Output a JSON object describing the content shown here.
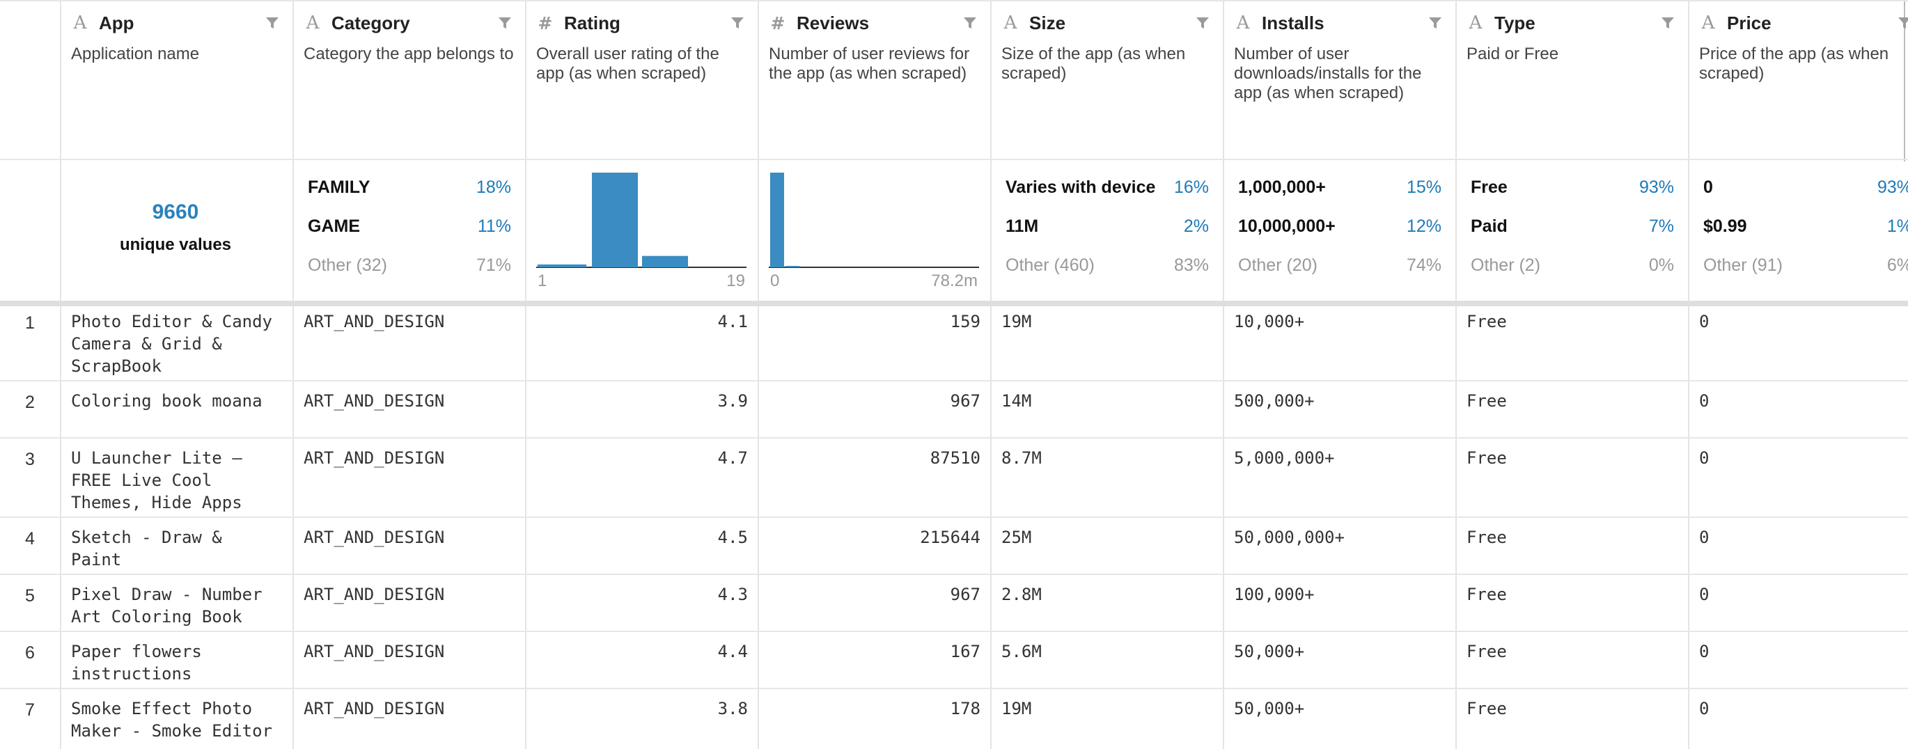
{
  "columns": [
    {
      "name": "App",
      "type": "text",
      "description": "Application name"
    },
    {
      "name": "Category",
      "type": "text",
      "description": "Category the app belongs to"
    },
    {
      "name": "Rating",
      "type": "number",
      "description": "Overall user rating of the app (as when scraped)"
    },
    {
      "name": "Reviews",
      "type": "number",
      "description": "Number of user reviews for the app (as when scraped)"
    },
    {
      "name": "Size",
      "type": "text",
      "description": "Size of the app (as when scraped)"
    },
    {
      "name": "Installs",
      "type": "text",
      "description": "Number of user downloads/installs for the app (as when scraped)"
    },
    {
      "name": "Type",
      "type": "text",
      "description": "Paid or Free"
    },
    {
      "name": "Price",
      "type": "text",
      "description": "Price of the app (as when scraped)"
    }
  ],
  "summary": {
    "app": {
      "unique_count": "9660",
      "unique_label": "unique values"
    },
    "category": [
      {
        "key": "FAMILY",
        "pct": "18%"
      },
      {
        "key": "GAME",
        "pct": "11%"
      },
      {
        "key": "Other (32)",
        "pct": "71%"
      }
    ],
    "rating": {
      "axis_min": "1",
      "axis_max": "19",
      "histogram": [
        0.03,
        1.0,
        0.12
      ]
    },
    "reviews": {
      "axis_min": "0",
      "axis_max": "78.2m",
      "histogram": [
        1.0,
        0.01
      ]
    },
    "size": [
      {
        "key": "Varies with device",
        "pct": "16%"
      },
      {
        "key": "11M",
        "pct": "2%"
      },
      {
        "key": "Other (460)",
        "pct": "83%"
      }
    ],
    "installs": [
      {
        "key": "1,000,000+",
        "pct": "15%"
      },
      {
        "key": "10,000,000+",
        "pct": "12%"
      },
      {
        "key": "Other (20)",
        "pct": "74%"
      }
    ],
    "type": [
      {
        "key": "Free",
        "pct": "93%"
      },
      {
        "key": "Paid",
        "pct": "7%"
      },
      {
        "key": "Other (2)",
        "pct": "0%"
      }
    ],
    "price": [
      {
        "key": "0",
        "pct": "93%"
      },
      {
        "key": "$0.99",
        "pct": "1%"
      },
      {
        "key": "Other (91)",
        "pct": "6%"
      }
    ]
  },
  "rows": [
    {
      "n": "1",
      "app": "Photo Editor & Candy Camera & Grid & ScrapBook",
      "category": "ART_AND_DESIGN",
      "rating": "4.1",
      "reviews": "159",
      "size": "19M",
      "installs": "10,000+",
      "type": "Free",
      "price": "0"
    },
    {
      "n": "2",
      "app": "Coloring book moana",
      "category": "ART_AND_DESIGN",
      "rating": "3.9",
      "reviews": "967",
      "size": "14M",
      "installs": "500,000+",
      "type": "Free",
      "price": "0"
    },
    {
      "n": "3",
      "app": "U Launcher Lite – FREE Live Cool Themes, Hide Apps",
      "category": "ART_AND_DESIGN",
      "rating": "4.7",
      "reviews": "87510",
      "size": "8.7M",
      "installs": "5,000,000+",
      "type": "Free",
      "price": "0"
    },
    {
      "n": "4",
      "app": "Sketch - Draw & Paint",
      "category": "ART_AND_DESIGN",
      "rating": "4.5",
      "reviews": "215644",
      "size": "25M",
      "installs": "50,000,000+",
      "type": "Free",
      "price": "0"
    },
    {
      "n": "5",
      "app": "Pixel Draw - Number Art Coloring Book",
      "category": "ART_AND_DESIGN",
      "rating": "4.3",
      "reviews": "967",
      "size": "2.8M",
      "installs": "100,000+",
      "type": "Free",
      "price": "0"
    },
    {
      "n": "6",
      "app": "Paper flowers instructions",
      "category": "ART_AND_DESIGN",
      "rating": "4.4",
      "reviews": "167",
      "size": "5.6M",
      "installs": "50,000+",
      "type": "Free",
      "price": "0"
    },
    {
      "n": "7",
      "app": "Smoke Effect Photo Maker - Smoke Editor",
      "category": "ART_AND_DESIGN",
      "rating": "3.8",
      "reviews": "178",
      "size": "19M",
      "installs": "50,000+",
      "type": "Free",
      "price": "0"
    }
  ]
}
